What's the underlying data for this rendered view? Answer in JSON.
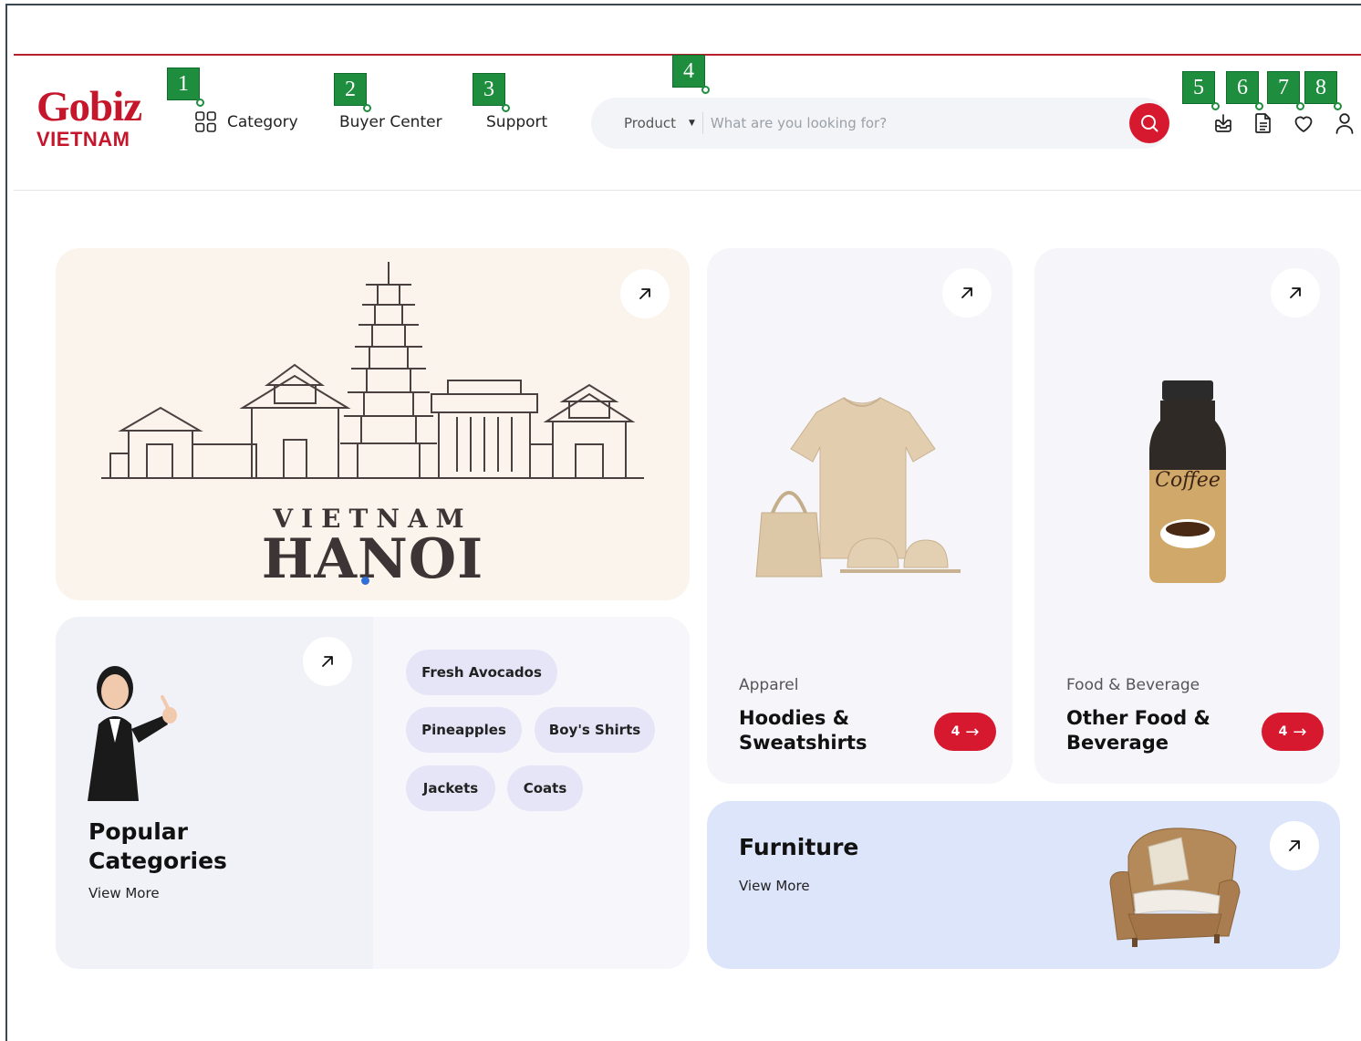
{
  "header": {
    "logo_brand": "Gobiz",
    "logo_country": "VIETNAM",
    "nav": {
      "category": "Category",
      "buyer_center": "Buyer Center",
      "support": "Support"
    },
    "search": {
      "scope": "Product",
      "placeholder": "What are you looking for?"
    },
    "icons": [
      "inbox-download-icon",
      "document-icon",
      "heart-icon",
      "user-icon"
    ]
  },
  "annotations": [
    "1",
    "2",
    "3",
    "4",
    "5",
    "6",
    "7",
    "8"
  ],
  "hero": {
    "country": "VIETNAM",
    "city": "HANOI"
  },
  "popular": {
    "title_line1": "Popular",
    "title_line2": "Categories",
    "view_more": "View More",
    "chips": [
      "Fresh Avocados",
      "Pineapples",
      "Boy's Shirts",
      "Jackets",
      "Coats"
    ]
  },
  "products": [
    {
      "category": "Apparel",
      "name_line1": "Hoodies &",
      "name_line2": "Sweatshirts",
      "count": "4"
    },
    {
      "category": "Food & Beverage",
      "name_line1": "Other Food &",
      "name_line2": "Beverage",
      "count": "4"
    }
  ],
  "furniture": {
    "title": "Furniture",
    "view_more": "View More"
  },
  "colors": {
    "brand_red": "#d7192f",
    "annotation_green": "#1e8e3e",
    "furniture_bg": "#dde5fb"
  }
}
